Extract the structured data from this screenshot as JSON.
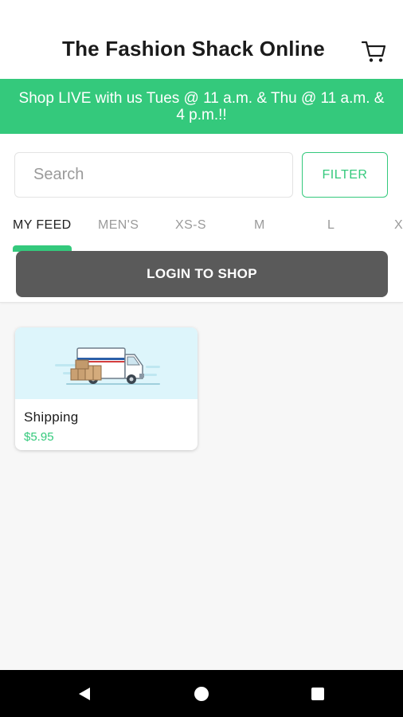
{
  "header": {
    "title": "The Fashion Shack Online",
    "cart_icon": "shopping-cart-icon"
  },
  "banner": {
    "text": "Shop LIVE with us Tues @ 11 a.m. & Thu @ 11 a.m. & 4 p.m.!!"
  },
  "search": {
    "placeholder": "Search",
    "value": ""
  },
  "filter": {
    "label": "FILTER"
  },
  "tabs": [
    {
      "label": "MY FEED",
      "active": true
    },
    {
      "label": "MEN'S",
      "active": false
    },
    {
      "label": "XS-S",
      "active": false
    },
    {
      "label": "M",
      "active": false
    },
    {
      "label": "L",
      "active": false
    },
    {
      "label": "X",
      "active": false
    }
  ],
  "login": {
    "label": "LOGIN TO SHOP"
  },
  "products": [
    {
      "name": "Shipping",
      "price": "$5.95",
      "image_icon": "delivery-truck-icon"
    }
  ],
  "colors": {
    "accent": "#34c97c",
    "login_button": "#5a5a5a",
    "card_image_bg": "#ddf5fb"
  },
  "navbar": {
    "back_icon": "back-triangle-icon",
    "home_icon": "home-circle-icon",
    "recents_icon": "recents-square-icon"
  }
}
